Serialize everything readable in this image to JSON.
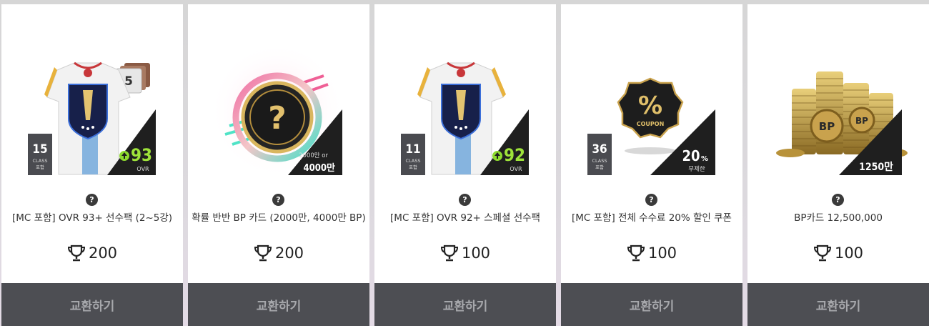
{
  "cards": [
    {
      "title": "[MC 포함] OVR 93+ 선수팩 (2~5강)",
      "price": "200",
      "button": "교환하기",
      "help": "?",
      "badge": {
        "count": "15",
        "line1": "CLASS",
        "line2": "포함"
      },
      "ovr": {
        "value": "93",
        "label": "OVR"
      },
      "enhance": "5"
    },
    {
      "title": "확률 반반 BP 카드 (2000만, 4000만 BP)",
      "price": "200",
      "button": "교환하기",
      "help": "?",
      "corner": {
        "small": "2000만 or",
        "big": "4000만"
      }
    },
    {
      "title": "[MC 포함] OVR 92+ 스페셜 선수팩",
      "price": "100",
      "button": "교환하기",
      "help": "?",
      "badge": {
        "count": "11",
        "line1": "CLASS",
        "line2": "포함"
      },
      "ovr": {
        "value": "92",
        "label": "OVR"
      }
    },
    {
      "title": "[MC 포함] 전체 수수료 20% 할인 쿠폰",
      "price": "100",
      "button": "교환하기",
      "help": "?",
      "badge": {
        "count": "36",
        "line1": "CLASS",
        "line2": "포함"
      },
      "coupon": {
        "symbol": "%",
        "word": "COUPON",
        "percent": "20",
        "unit": "%",
        "sub": "무제한"
      }
    },
    {
      "title": "BP카드 12,500,000",
      "price": "100",
      "button": "교환하기",
      "help": "?",
      "coins": {
        "mark": "BP",
        "corner": "1250만"
      }
    }
  ]
}
